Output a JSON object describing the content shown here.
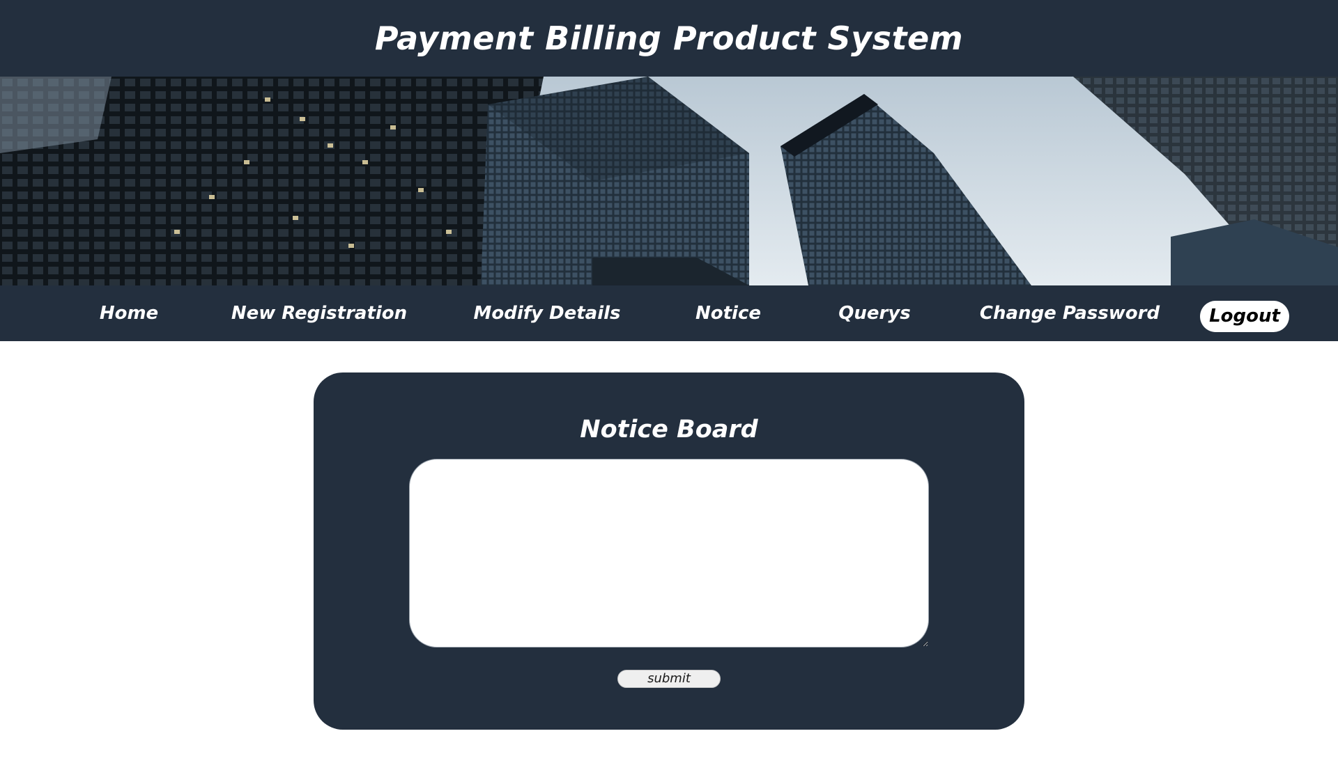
{
  "header": {
    "title": "Payment Billing Product System"
  },
  "banner": {
    "image": "city-skyscrapers-banner"
  },
  "nav": {
    "items": [
      {
        "label": "Home"
      },
      {
        "label": "New Registration"
      },
      {
        "label": "Modify Details"
      },
      {
        "label": "Notice"
      },
      {
        "label": "Querys"
      },
      {
        "label": "Change Password"
      }
    ],
    "logout_label": "Logout"
  },
  "notice_board": {
    "title": "Notice Board",
    "textarea_value": "",
    "submit_label": "submit"
  },
  "colors": {
    "navy": "#232f3e",
    "white": "#ffffff",
    "button_gray": "#efefef"
  }
}
